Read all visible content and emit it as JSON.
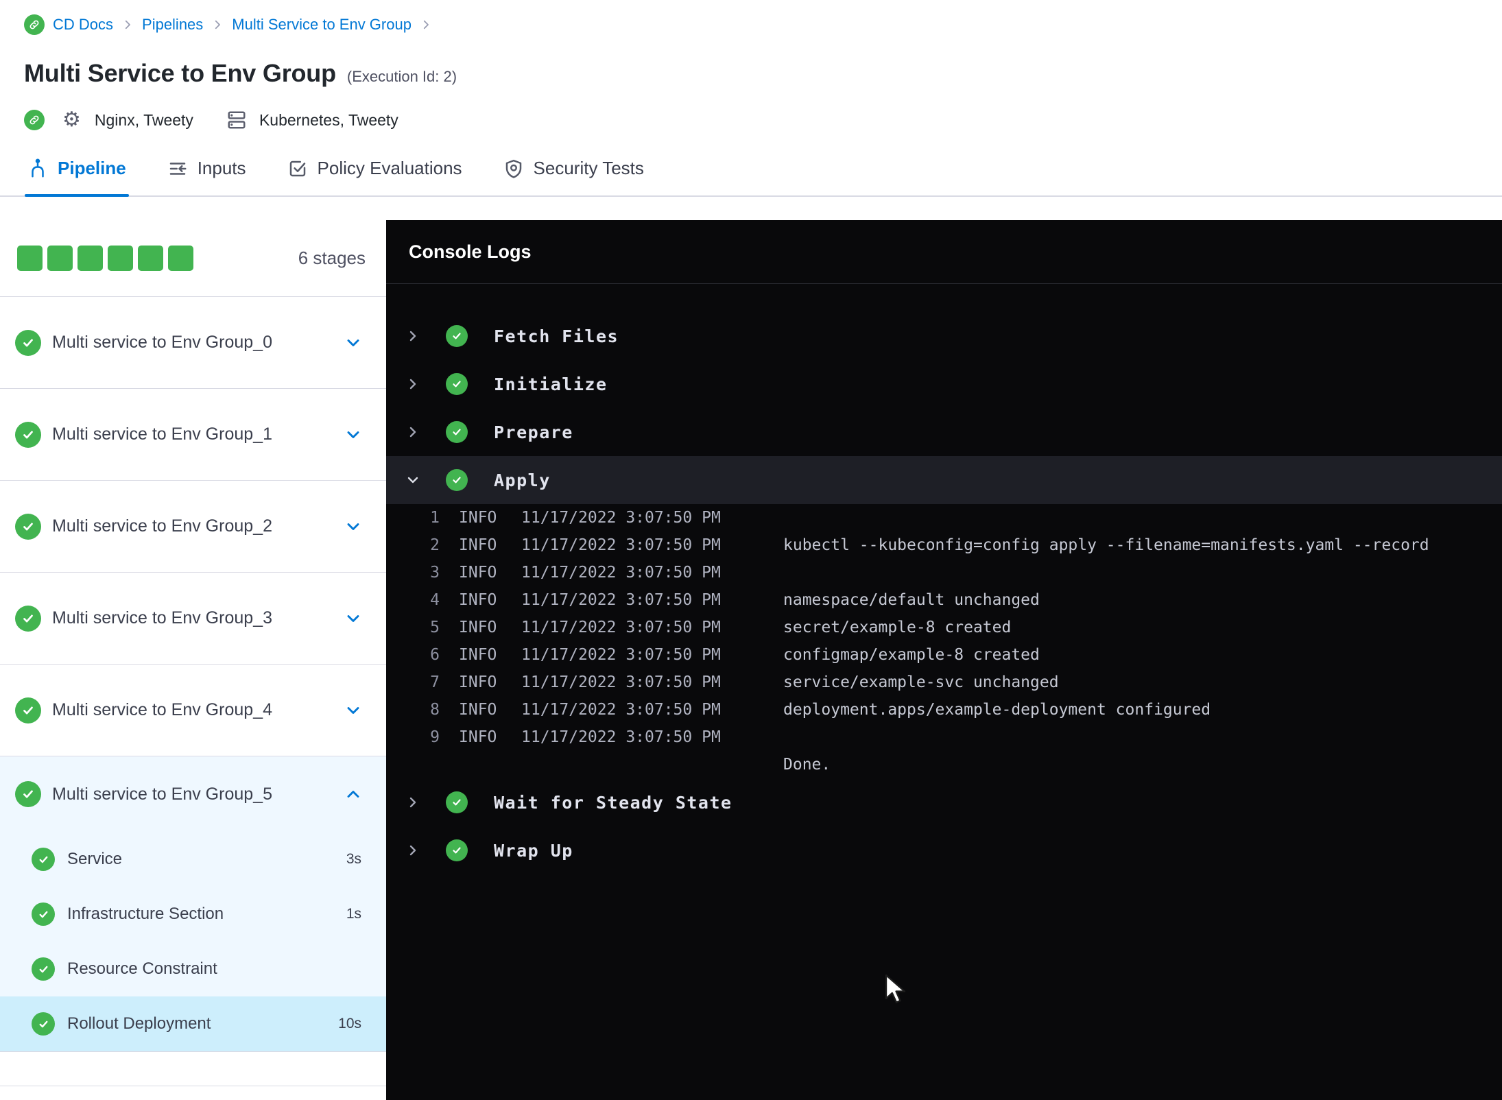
{
  "breadcrumb": {
    "items": [
      "CD Docs",
      "Pipelines",
      "Multi Service to Env Group"
    ]
  },
  "header": {
    "title": "Multi Service to Env Group",
    "execution_id": "(Execution Id: 2)",
    "services_label": "Nginx, Tweety",
    "environments_label": "Kubernetes, Tweety"
  },
  "tabs": [
    {
      "label": "Pipeline",
      "active": true
    },
    {
      "label": "Inputs",
      "active": false
    },
    {
      "label": "Policy Evaluations",
      "active": false
    },
    {
      "label": "Security Tests",
      "active": false
    }
  ],
  "sidebar": {
    "stages_count": "6 stages",
    "stages": [
      {
        "label": "Multi service to Env Group_0",
        "status": "success",
        "expanded": false
      },
      {
        "label": "Multi service to Env Group_1",
        "status": "success",
        "expanded": false
      },
      {
        "label": "Multi service to Env Group_2",
        "status": "success",
        "expanded": false
      },
      {
        "label": "Multi service to Env Group_3",
        "status": "success",
        "expanded": false
      },
      {
        "label": "Multi service to Env Group_4",
        "status": "success",
        "expanded": false
      },
      {
        "label": "Multi service to Env Group_5",
        "status": "success",
        "expanded": true,
        "steps": [
          {
            "label": "Service",
            "duration": "3s",
            "status": "success",
            "selected": false
          },
          {
            "label": "Infrastructure Section",
            "duration": "1s",
            "status": "success",
            "selected": false
          },
          {
            "label": "Resource Constraint",
            "duration": "",
            "status": "success",
            "selected": false
          },
          {
            "label": "Rollout Deployment",
            "duration": "10s",
            "status": "success",
            "selected": true
          }
        ]
      }
    ]
  },
  "console": {
    "title": "Console Logs",
    "sections": [
      {
        "label": "Fetch Files",
        "status": "success",
        "expanded": false
      },
      {
        "label": "Initialize",
        "status": "success",
        "expanded": false
      },
      {
        "label": "Prepare",
        "status": "success",
        "expanded": false
      },
      {
        "label": "Apply",
        "status": "success",
        "expanded": true,
        "logs": [
          {
            "n": "1",
            "level": "INFO",
            "time": "11/17/2022 3:07:50 PM",
            "msg": ""
          },
          {
            "n": "2",
            "level": "INFO",
            "time": "11/17/2022 3:07:50 PM",
            "msg": "kubectl --kubeconfig=config apply --filename=manifests.yaml --record"
          },
          {
            "n": "3",
            "level": "INFO",
            "time": "11/17/2022 3:07:50 PM",
            "msg": ""
          },
          {
            "n": "4",
            "level": "INFO",
            "time": "11/17/2022 3:07:50 PM",
            "msg": "namespace/default unchanged"
          },
          {
            "n": "5",
            "level": "INFO",
            "time": "11/17/2022 3:07:50 PM",
            "msg": "secret/example-8 created"
          },
          {
            "n": "6",
            "level": "INFO",
            "time": "11/17/2022 3:07:50 PM",
            "msg": "configmap/example-8 created"
          },
          {
            "n": "7",
            "level": "INFO",
            "time": "11/17/2022 3:07:50 PM",
            "msg": "service/example-svc unchanged"
          },
          {
            "n": "8",
            "level": "INFO",
            "time": "11/17/2022 3:07:50 PM",
            "msg": "deployment.apps/example-deployment configured"
          },
          {
            "n": "9",
            "level": "INFO",
            "time": "11/17/2022 3:07:50 PM",
            "msg": ""
          },
          {
            "n": "",
            "level": "",
            "time": "",
            "msg": "Done."
          }
        ]
      },
      {
        "label": "Wait for Steady State",
        "status": "success",
        "expanded": false
      },
      {
        "label": "Wrap Up",
        "status": "success",
        "expanded": false
      }
    ]
  },
  "colors": {
    "accent_blue": "#0278d5",
    "success_green": "#42b450",
    "console_bg": "#09090b",
    "expanded_stage_bg": "#eff8ff",
    "selected_step_bg": "#cdeefc"
  }
}
